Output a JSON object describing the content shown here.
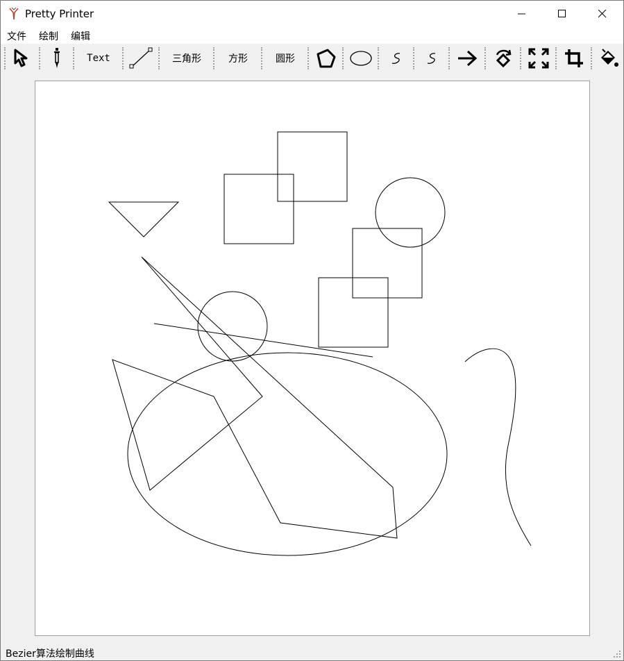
{
  "window": {
    "title": "Pretty Printer",
    "app_icon": "pen-icon",
    "controls": {
      "minimize": "minimize-icon",
      "maximize": "maximize-icon",
      "close": "close-icon"
    }
  },
  "menu": {
    "file": "文件",
    "draw": "绘制",
    "edit": "编辑"
  },
  "toolbar": {
    "select_icon": "cursor-icon",
    "pen_icon": "eyedropper-icon",
    "text_label": "Text",
    "line_icon": "line-icon",
    "triangle_label": "三角形",
    "square_label": "方形",
    "circle_label": "圆形",
    "polygon_icon": "pentagon-icon",
    "ellipse_icon": "ellipse-icon",
    "bezier_icon": "curve-icon",
    "bspline_icon": "curve-icon",
    "translate_icon": "arrow-right-icon",
    "rotate_icon": "rotate-icon",
    "scale_icon": "expand-icon",
    "clip_icon": "crop-icon",
    "fill_icon": "paint-bucket-icon"
  },
  "status": {
    "message": "Bezier算法绘制曲线"
  },
  "colors": {
    "window_bg": "#f0f0f0",
    "canvas_bg": "#ffffff",
    "stroke": "#000000"
  }
}
